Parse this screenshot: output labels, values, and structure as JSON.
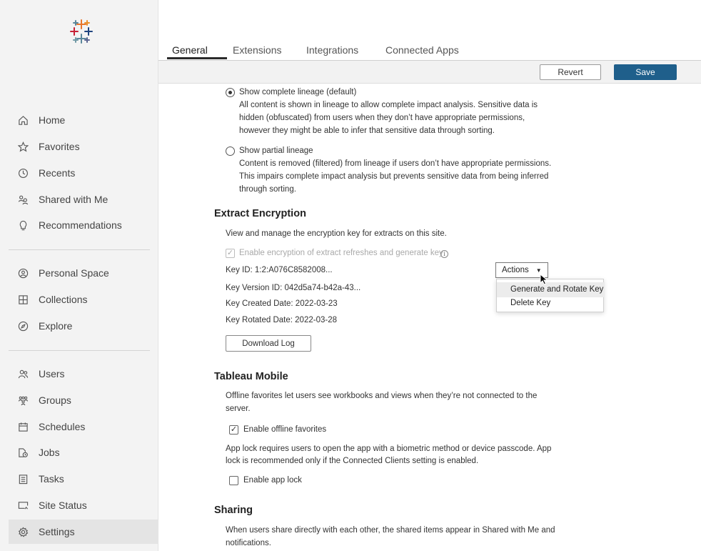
{
  "sidebar": {
    "items": [
      {
        "label": "Home",
        "icon": "home-icon"
      },
      {
        "label": "Favorites",
        "icon": "star-icon"
      },
      {
        "label": "Recents",
        "icon": "clock-icon"
      },
      {
        "label": "Shared with Me",
        "icon": "shared-users-icon"
      },
      {
        "label": "Recommendations",
        "icon": "lightbulb-icon"
      },
      {
        "label": "Personal Space",
        "icon": "person-circle-icon"
      },
      {
        "label": "Collections",
        "icon": "collections-icon"
      },
      {
        "label": "Explore",
        "icon": "compass-icon"
      },
      {
        "label": "Users",
        "icon": "users-icon"
      },
      {
        "label": "Groups",
        "icon": "groups-icon"
      },
      {
        "label": "Schedules",
        "icon": "calendar-icon"
      },
      {
        "label": "Jobs",
        "icon": "jobs-icon"
      },
      {
        "label": "Tasks",
        "icon": "tasks-icon"
      },
      {
        "label": "Site Status",
        "icon": "site-status-icon"
      },
      {
        "label": "Settings",
        "icon": "gear-icon"
      }
    ],
    "active": "Settings"
  },
  "tabs": [
    {
      "label": "General",
      "active": true
    },
    {
      "label": "Extensions",
      "active": false
    },
    {
      "label": "Integrations",
      "active": false
    },
    {
      "label": "Connected Apps",
      "active": false
    }
  ],
  "toolbar": {
    "revert_label": "Revert",
    "save_label": "Save"
  },
  "lineage": {
    "complete_label": "Show complete lineage (default)",
    "complete_desc": [
      "All content is shown in lineage to allow complete impact analysis. Sensitive data is",
      "hidden (obfuscated) from users when they don’t have appropriate permissions,",
      "however they might be able to infer that sensitive data through sorting."
    ],
    "partial_label": "Show partial lineage",
    "partial_desc": [
      "Content is removed (filtered) from lineage if users don’t have appropriate permissions.",
      "This impairs complete impact analysis but prevents sensitive data from being inferred",
      "through sorting."
    ],
    "selected": "complete"
  },
  "extract_encryption": {
    "heading": "Extract Encryption",
    "desc": "View and manage the encryption key for extracts on this site.",
    "checkbox_label": "Enable encryption of extract refreshes and generate key",
    "checkbox_checked": true,
    "checkbox_disabled": true,
    "key_id": "Key ID: 1:2:A076C8582008...",
    "key_version": "Key Version ID: 042d5a74-b42a-43...",
    "key_created": "Key Created Date: 2022-03-23",
    "key_rotated": "Key Rotated Date: 2022-03-28",
    "download_label": "Download Log",
    "actions_label": "Actions",
    "actions_menu": [
      "Generate and Rotate Key",
      "Delete Key"
    ]
  },
  "mobile": {
    "heading": "Tableau Mobile",
    "offline_desc": [
      "Offline favorites let users see workbooks and views when they’re not connected to the",
      "server."
    ],
    "offline_label": "Enable offline favorites",
    "offline_checked": true,
    "applock_desc": [
      "App lock requires users to open the app with a biometric method or device passcode. App",
      "lock is recommended only if the Connected Clients setting is enabled."
    ],
    "applock_label": "Enable app lock",
    "applock_checked": false
  },
  "sharing": {
    "heading": "Sharing",
    "desc": [
      "When users share directly with each other, the shared items appear in Shared with Me and",
      "notifications."
    ]
  },
  "colors": {
    "save_button": "#1f5f8b",
    "sidebar_bg": "#f3f3f3",
    "active_nav_bg": "#e4e4e4"
  }
}
